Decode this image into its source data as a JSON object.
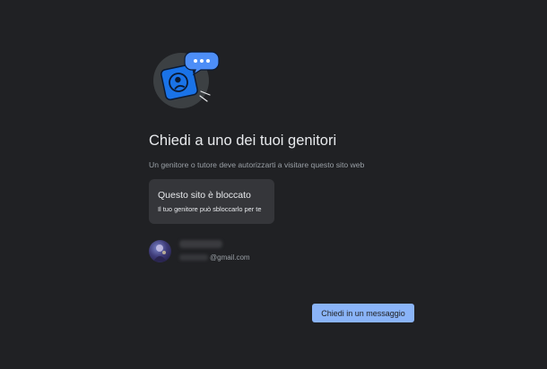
{
  "main": {
    "title": "Chiedi a uno dei tuoi genitori",
    "subtitle": "Un genitore o tutore deve autorizzarti a visitare questo sito web"
  },
  "blocked_card": {
    "title": "Questo sito è bloccato",
    "description": "Il tuo genitore può sbloccarlo per te"
  },
  "account": {
    "email_domain": "@gmail.com"
  },
  "actions": {
    "ask_button_label": "Chiedi in un messaggio"
  },
  "icons": {
    "illustration": "parent-supervision-icon",
    "chat_bubble": "chat-bubble-icon"
  },
  "colors": {
    "background": "#202124",
    "card": "#35363a",
    "accent": "#8ab4f8",
    "illustration_blue": "#1a73e8"
  }
}
